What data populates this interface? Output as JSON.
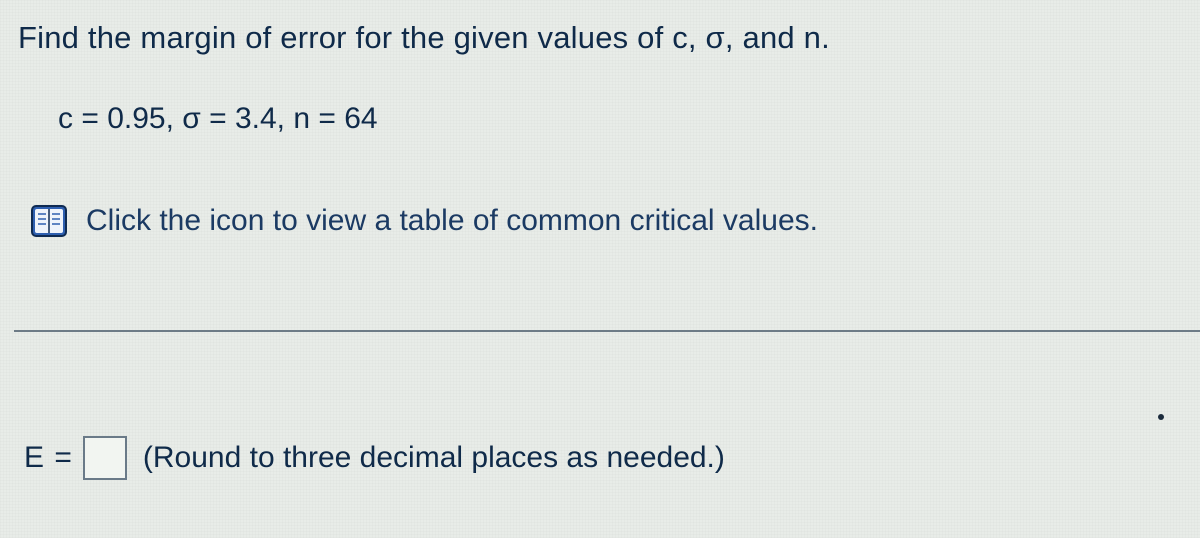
{
  "question": {
    "prompt": "Find the margin of error for the given values of c, σ, and n.",
    "given": "c = 0.95, σ = 3.4, n = 64",
    "link_text": "Click the icon to view a table of common critical values."
  },
  "answer": {
    "label": "E =",
    "value": "",
    "hint": "(Round to three decimal places as needed.)"
  }
}
